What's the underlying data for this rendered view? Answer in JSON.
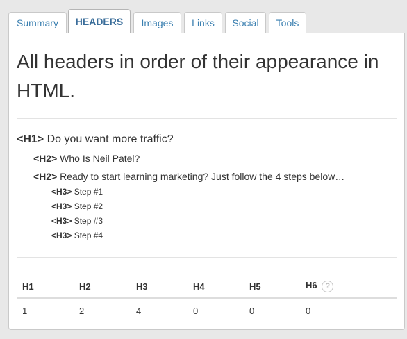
{
  "tabs": [
    {
      "label": "Summary",
      "active": false
    },
    {
      "label": "HEADERS",
      "active": true
    },
    {
      "label": "Images",
      "active": false
    },
    {
      "label": "Links",
      "active": false
    },
    {
      "label": "Social",
      "active": false
    },
    {
      "label": "Tools",
      "active": false
    }
  ],
  "panel": {
    "title": "All headers in order of their appearance in HTML.",
    "headers": [
      {
        "tag": "<H1>",
        "text": "Do you want more traffic?"
      },
      {
        "tag": "<H2>",
        "text": "Who Is Neil Patel?"
      },
      {
        "tag": "<H2>",
        "text": "Ready to start learning marketing? Just follow the 4 steps below…"
      },
      {
        "tag": "<H3>",
        "text": "Step #1"
      },
      {
        "tag": "<H3>",
        "text": "Step #2"
      },
      {
        "tag": "<H3>",
        "text": "Step #3"
      },
      {
        "tag": "<H3>",
        "text": "Step #4"
      }
    ],
    "counts_table": {
      "columns": [
        "H1",
        "H2",
        "H3",
        "H4",
        "H5",
        "H6"
      ],
      "values": [
        "1",
        "2",
        "4",
        "0",
        "0",
        "0"
      ],
      "help_icon": "question-icon",
      "help_glyph": "?"
    }
  },
  "colors": {
    "tab_text": "#3a7fb0",
    "active_tab_text": "#3a6d9a",
    "background": "#e8e8e8",
    "panel": "#ffffff"
  }
}
